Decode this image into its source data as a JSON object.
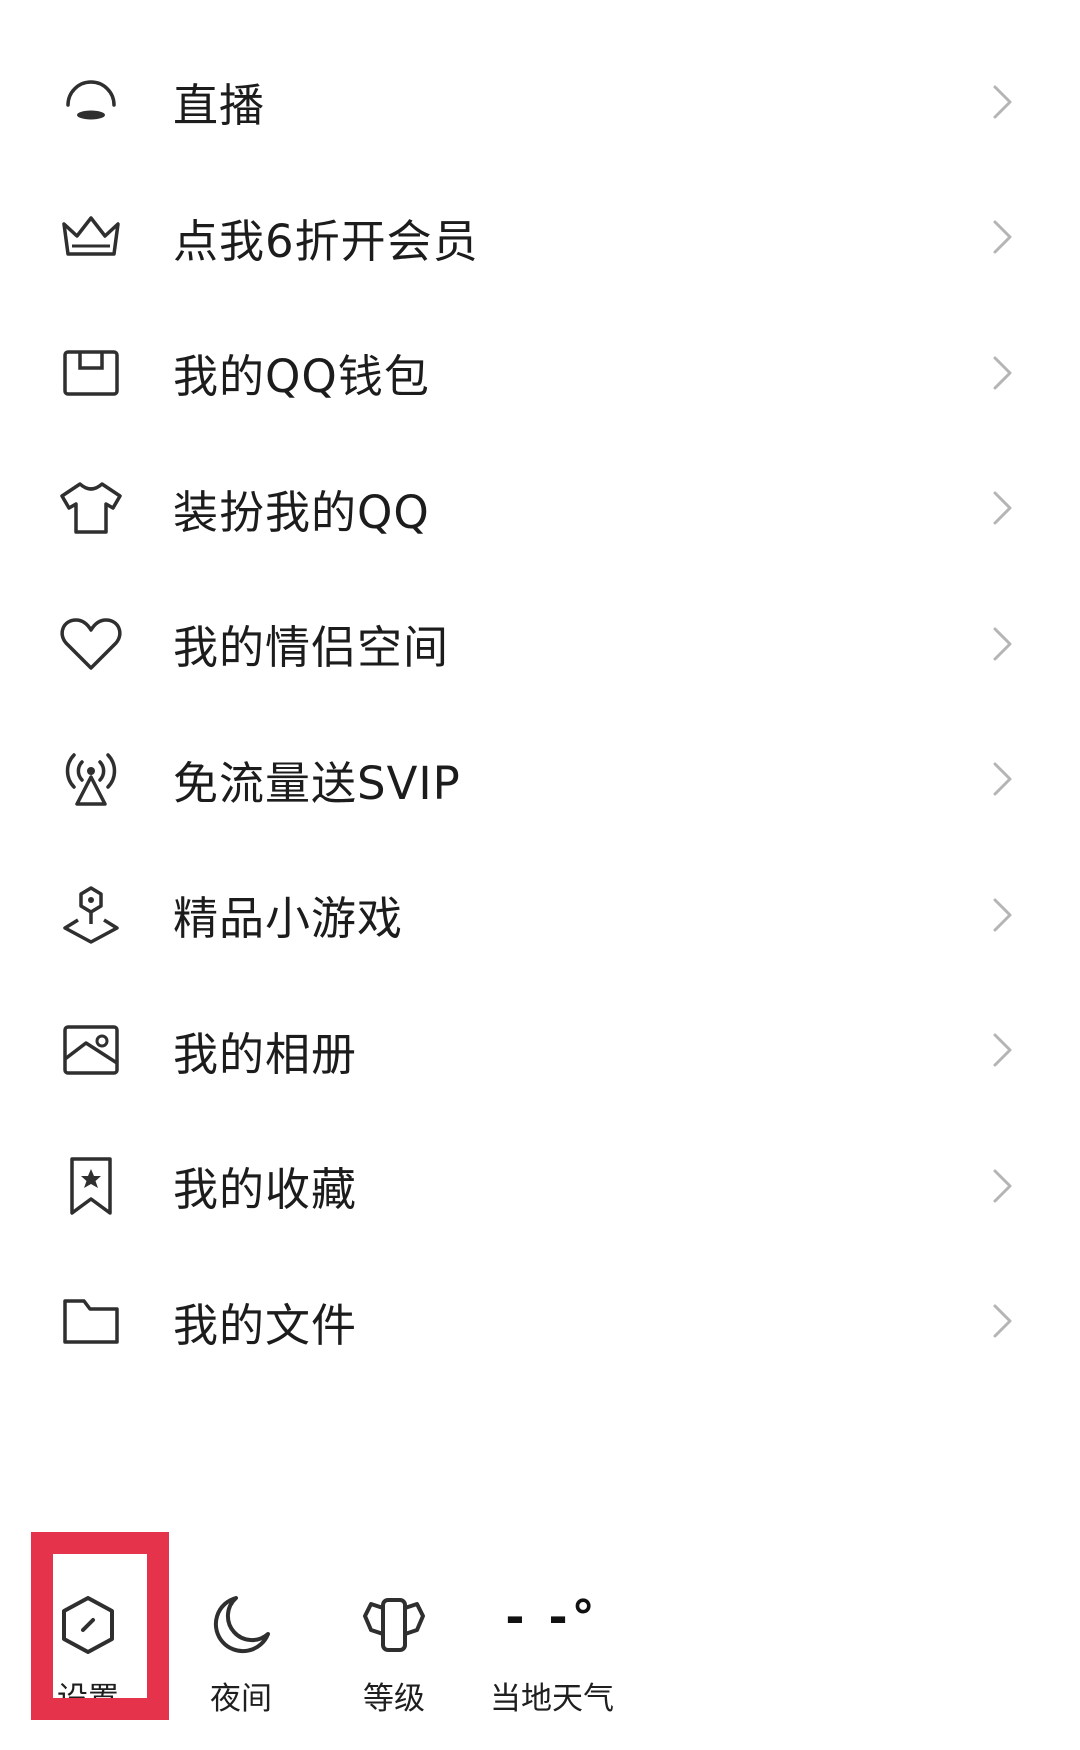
{
  "menu": {
    "items": [
      {
        "label": "直播",
        "icon": "live-icon"
      },
      {
        "label": "点我6折开会员",
        "icon": "crown-icon"
      },
      {
        "label": "我的QQ钱包",
        "icon": "wallet-icon"
      },
      {
        "label": "装扮我的QQ",
        "icon": "tshirt-icon"
      },
      {
        "label": "我的情侣空间",
        "icon": "heart-icon"
      },
      {
        "label": "免流量送SVIP",
        "icon": "signal-tower-icon"
      },
      {
        "label": "精品小游戏",
        "icon": "game-pin-icon"
      },
      {
        "label": "我的相册",
        "icon": "photo-album-icon"
      },
      {
        "label": "我的收藏",
        "icon": "bookmark-star-icon"
      },
      {
        "label": "我的文件",
        "icon": "folder-icon"
      }
    ],
    "chevron_icon": "chevron-right-icon"
  },
  "bottom_bar": {
    "settings_label": "设置",
    "night_label": "夜间",
    "level_label": "等级",
    "weather_label": "当地天气",
    "weather_temp": "- -°"
  },
  "colors": {
    "text": "#1c1c1c",
    "icon": "#333333",
    "chevron": "#b5b5b5",
    "highlight": "#e4334a"
  }
}
